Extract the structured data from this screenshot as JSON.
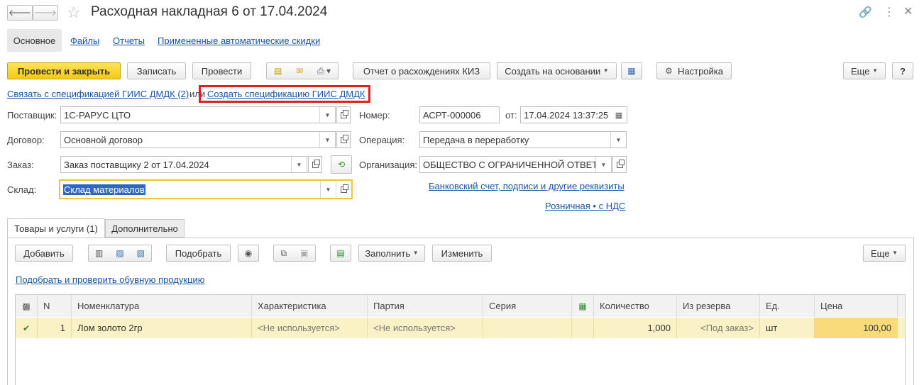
{
  "title": "Расходная накладная 6 от 17.04.2024",
  "nav_tabs": [
    "Основное",
    "Файлы",
    "Отчеты",
    "Примененные автоматические скидки"
  ],
  "toolbar": {
    "post_close": "Провести и закрыть",
    "write": "Записать",
    "post": "Провести",
    "kiz_report": "Отчет о расхождениях КИЗ",
    "create_based": "Создать на основании",
    "settings": "Настройка",
    "more": "Еще",
    "help": "?"
  },
  "gisdmdk": {
    "link_bind": "Связать с спецификацией ГИИС ДМДК (2)",
    "or": "или",
    "link_create": "Создать спецификацию ГИИС ДМДК"
  },
  "form": {
    "supplier_label": "Поставщик:",
    "supplier_value": "1С-РАРУС ЦТО",
    "contract_label": "Договор:",
    "contract_value": "Основной договор",
    "order_label": "Заказ:",
    "order_value": "Заказ поставщику 2 от 17.04.2024",
    "warehouse_label": "Склад:",
    "warehouse_value": "Склад материалов",
    "number_label": "Номер:",
    "number_value": "АСРТ-000006",
    "date_label": "от:",
    "date_value": "17.04.2024 13:37:25",
    "operation_label": "Операция:",
    "operation_value": "Передача в переработку",
    "org_label": "Организация:",
    "org_value": "ОБЩЕСТВО С ОГРАНИЧЕННОЙ ОТВЕТ",
    "bank_link": "Банковский счет, подписи и другие реквизиты",
    "price_link": "Розничная • с НДС"
  },
  "doc_tabs": [
    "Товары и услуги (1)",
    "Дополнительно"
  ],
  "table_toolbar": {
    "add": "Добавить",
    "pick": "Подобрать",
    "fill": "Заполнить",
    "change": "Изменить",
    "more": "Еще"
  },
  "shoe_link": "Подобрать и проверить обувную продукцию",
  "table": {
    "columns": [
      "N",
      "Номенклатура",
      "Характеристика",
      "Партия",
      "Серия",
      "Количество",
      "Из резерва",
      "Ед.",
      "Цена"
    ],
    "rows": [
      {
        "n": "1",
        "item": "Лом золото 2гр",
        "characteristic": "<Не используется>",
        "batch": "<Не используется>",
        "series": "",
        "quantity": "1,000",
        "reserve": "<Под заказ>",
        "unit": "шт",
        "price": "100,00"
      }
    ]
  },
  "colors": {
    "primary_button": "#f5c815",
    "highlight_box": "#e02020",
    "link": "#1a55a3",
    "row_selected": "#fbf1c6",
    "focus_border": "#f0c23b"
  }
}
